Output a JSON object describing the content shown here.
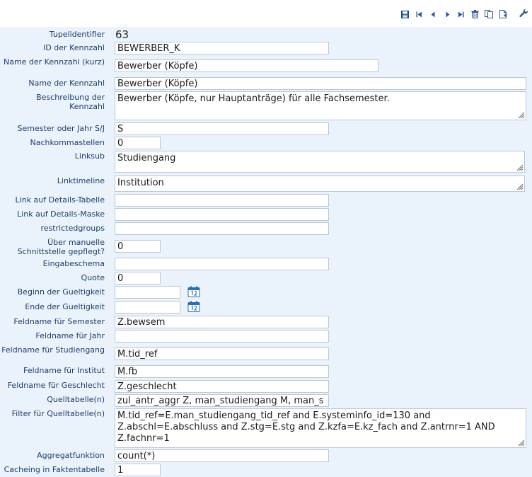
{
  "toolbar": {
    "buttons": [
      "save-icon",
      "first-icon",
      "prev-icon",
      "next-icon",
      "last-icon",
      "delete-icon",
      "copy-icon",
      "new-icon",
      "settings-icon"
    ]
  },
  "form": {
    "tupelidentifier": {
      "label": "Tupelidentifier",
      "value": "63"
    },
    "id_kennzahl": {
      "label": "ID der Kennzahl",
      "value": "BEWERBER_K"
    },
    "name_kurz": {
      "label": "Name der Kennzahl (kurz)",
      "value": "Bewerber (Köpfe)"
    },
    "name": {
      "label": "Name der Kennzahl",
      "value": "Bewerber (Köpfe)"
    },
    "beschreibung": {
      "label": "Beschreibung der Kennzahl",
      "value": "Bewerber (Köpfe, nur Hauptanträge) für alle Fachsemester."
    },
    "semester_jahr": {
      "label": "Semester oder Jahr S/J",
      "value": "S"
    },
    "nachkommastellen": {
      "label": "Nachkommastellen",
      "value": "0"
    },
    "linksub": {
      "label": "Linksub",
      "value": "Studiengang"
    },
    "linktimeline": {
      "label": "Linktimeline",
      "value": "Institution"
    },
    "link_details_tabelle": {
      "label": "Link auf Details-Tabelle",
      "value": ""
    },
    "link_details_maske": {
      "label": "Link auf Details-Maske",
      "value": ""
    },
    "restrictedgroups": {
      "label": "restrictedgroups",
      "value": ""
    },
    "manuelle_schnittstelle": {
      "label": "Über manuelle Schnittstelle gepflegt?",
      "value": "0"
    },
    "eingabeschema": {
      "label": "Eingabeschema",
      "value": ""
    },
    "quote": {
      "label": "Quote",
      "value": "0"
    },
    "beginn_gueltigkeit": {
      "label": "Beginn der Gueltigkeit",
      "value": ""
    },
    "ende_gueltigkeit": {
      "label": "Ende der Gueltigkeit",
      "value": ""
    },
    "feldname_semester": {
      "label": "Feldname für Semester",
      "value": "Z.bewsem"
    },
    "feldname_jahr": {
      "label": "Feldname für Jahr",
      "value": ""
    },
    "feldname_studiengang": {
      "label": "Feldname für Studiengang",
      "value": "M.tid_ref"
    },
    "feldname_institut": {
      "label": "Feldname für Institut",
      "value": "M.fb"
    },
    "feldname_geschlecht": {
      "label": "Feldname für Geschlecht",
      "value": "Z.geschlecht"
    },
    "quelltabellen": {
      "label": "Quelltabelle(n)",
      "value": "zul_antr_aggr Z, man_studiengang M, man_s"
    },
    "filter_quelltabellen": {
      "label": "Filter für Quelltabelle(n)",
      "value": "M.tid_ref=E.man_studiengang_tid_ref and E.systeminfo_id=130 and Z.abschl=E.abschluss and Z.stg=E.stg and Z.kzfa=E.kz_fach and Z.antrnr=1 AND Z.fachnr=1"
    },
    "aggregatfunktion": {
      "label": "Aggregatfunktion",
      "value": "count(*)"
    },
    "cacheing": {
      "label": "Cacheing in Faktentabelle",
      "value": "1"
    }
  }
}
